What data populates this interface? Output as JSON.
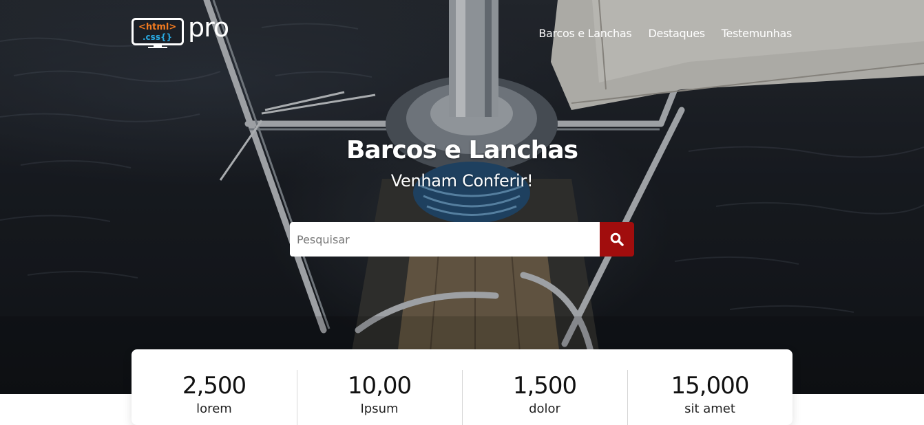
{
  "brand": {
    "logo_line1": "<html>",
    "logo_line2": ".css{}",
    "logo_suffix": "pro"
  },
  "nav": {
    "items": [
      "Barcos e Lanchas",
      "Destaques",
      "Testemunhas"
    ]
  },
  "hero": {
    "title": "Barcos e Lanchas",
    "subtitle": "Venham Conferir!",
    "search_placeholder": "Pesquisar",
    "search_icon": "search-icon"
  },
  "stats": [
    {
      "value": "2,500",
      "label": "lorem"
    },
    {
      "value": "10,00",
      "label": "Ipsum"
    },
    {
      "value": "1,500",
      "label": "dolor"
    },
    {
      "value": "15,000",
      "label": "sit amet"
    }
  ],
  "colors": {
    "accent": "#a10d0d",
    "logo_orange": "#f47b20",
    "logo_blue": "#29a8e0"
  }
}
